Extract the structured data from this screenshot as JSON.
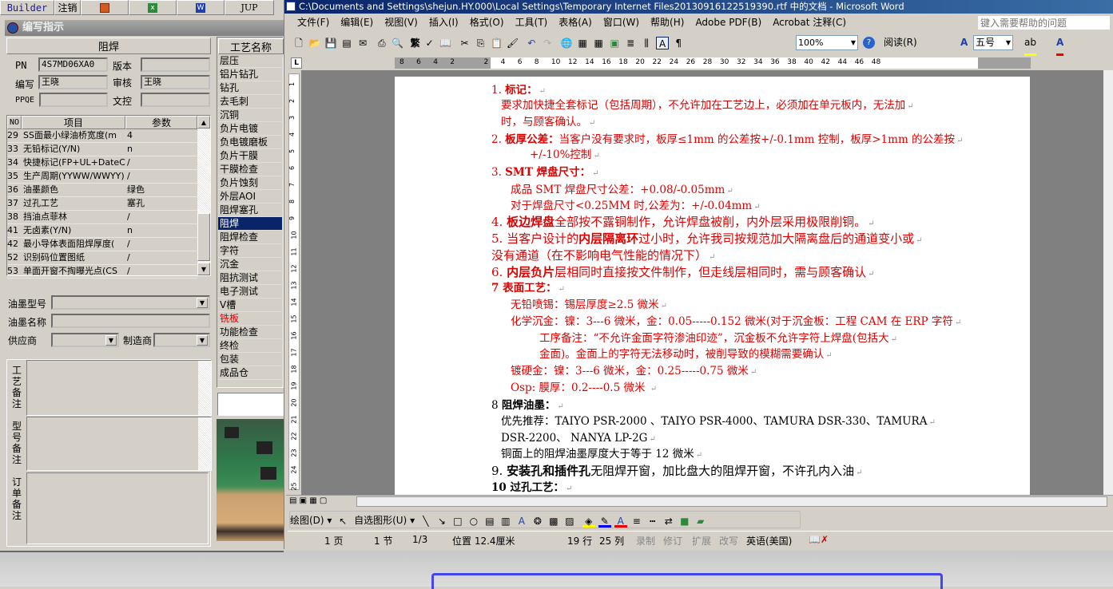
{
  "left_app": {
    "toolbar": {
      "builder": "Builder",
      "logout": "注销",
      "ppt_icon": "powerpoint-icon",
      "excel_icon": "excel-icon",
      "word_icon": "word-icon",
      "jup": "JUP"
    },
    "panel_title": "编写指示",
    "section_title": "阻焊",
    "fields": {
      "pn_label": "PN",
      "pn_value": "4S7MD06XA0",
      "version_label": "版本",
      "version_value": "",
      "writer_label": "编写",
      "writer_value": "王晓",
      "reviewer_label": "审核",
      "reviewer_value": "王晓",
      "ppqe_label": "PPQE",
      "ppqe_value": "",
      "doc_control_label": "文控",
      "doc_control_value": ""
    },
    "table": {
      "headers": [
        "NO",
        "项目",
        "参数"
      ],
      "rows": [
        [
          "29",
          "SS面最小绿油桥宽度(m",
          "4"
        ],
        [
          "33",
          "无铅标记(Y/N)",
          "n"
        ],
        [
          "34",
          "快捷标记(FP+UL+DateCo",
          "/"
        ],
        [
          "35",
          "生产周期(YYWW/WWYY)",
          "/"
        ],
        [
          "36",
          "油墨颜色",
          "绿色"
        ],
        [
          "37",
          "过孔工艺",
          "塞孔"
        ],
        [
          "38",
          "挡油点菲林",
          "/"
        ],
        [
          "41",
          "无卤素(Y/N)",
          "n"
        ],
        [
          "42",
          "最小导体表面阻焊厚度(",
          "/"
        ],
        [
          "52",
          "识别码位置图纸",
          "/"
        ],
        [
          "53",
          "单面开窗不掏曝光点(CS",
          "/"
        ]
      ]
    },
    "ink_model_label": "油墨型号",
    "ink_model_value": "",
    "ink_name_label": "油墨名称",
    "ink_name_value": "",
    "supplier_label": "供应商",
    "supplier_value": "",
    "manufacturer_label": "制造商",
    "manufacturer_value": "",
    "remarks": {
      "process": "工艺备注",
      "model": "型号备注",
      "order": "订单备注"
    },
    "process_list": {
      "header": "工艺名称",
      "selected": "阻焊",
      "highlight_color": "#e00000",
      "items": [
        "层压",
        "铝片钻孔",
        "钻孔",
        "去毛刺",
        "沉铜",
        "负片电镀",
        "负电镀磨板",
        "负片干膜",
        "干膜检查",
        "负片蚀刻",
        "外层AOI",
        "阻焊塞孔",
        "阻焊",
        "阻焊检查",
        "字符",
        "沉金",
        "阻抗测试",
        "电子测试",
        "V槽",
        "铣板",
        "功能检查",
        "终检",
        "包装",
        "成品仓"
      ],
      "highlighted": "铣板"
    }
  },
  "word": {
    "title": "C:\\Documents and Settings\\shejun.HY.000\\Local Settings\\Temporary Internet Files20130916122519390.rtf 中的文档 - Microsoft Word",
    "menu": [
      "文件(F)",
      "编辑(E)",
      "视图(V)",
      "插入(I)",
      "格式(O)",
      "工具(T)",
      "表格(A)",
      "窗口(W)",
      "帮助(H)",
      "Adobe PDF(B)",
      "Acrobat 注释(C)"
    ],
    "help_placeholder": "键入需要帮助的问题",
    "toolbar": {
      "traditional": "繁",
      "zoom": "100%",
      "read": "阅读(R)",
      "font_size": "五号"
    },
    "ruler_ticks": [
      "8",
      "6",
      "4",
      "2",
      "",
      "2",
      "4",
      "6",
      "8",
      "10",
      "12",
      "14",
      "16",
      "18",
      "20",
      "22",
      "24",
      "26",
      "28",
      "30",
      "32",
      "34",
      "36",
      "38",
      "40",
      "42",
      "44",
      "46",
      "48"
    ],
    "vruler_ticks": [
      "1",
      "2",
      "3",
      "4",
      "5",
      "6",
      "7",
      "8",
      "9",
      "10",
      "11",
      "12",
      "13",
      "14",
      "15",
      "16",
      "17",
      "18",
      "19",
      "20",
      "21",
      "22",
      "23",
      "24",
      "25"
    ],
    "doc_lines": [
      {
        "segs": [
          {
            "t": "1.  ",
            "b": false
          },
          {
            "t": "标记：",
            "b": true
          }
        ]
      },
      {
        "segs": [
          {
            "t": "要求加快捷全套标记（包括周期），不允许加在工艺边上，必须加在单元板内，无法加",
            "b": false
          }
        ],
        "indent": 1
      },
      {
        "segs": [
          {
            "t": "时，与顾客确认。",
            "b": false
          }
        ],
        "indent": 1
      },
      {
        "segs": [
          {
            "t": "2. ",
            "b": false
          },
          {
            "t": "板厚公差：",
            "b": true
          },
          {
            "t": "当客户没有要求时，板厚≤1mm 的公差按+/-0.1mm 控制，板厚>1mm 的公差按",
            "b": false
          }
        ]
      },
      {
        "segs": [
          {
            "t": "+/-10%控制",
            "b": false
          }
        ],
        "indent": 4
      },
      {
        "segs": [
          {
            "t": "3.  ",
            "b": false
          },
          {
            "t": "SMT 焊盘尺寸：",
            "b": true
          }
        ]
      },
      {
        "segs": [
          {
            "t": "成品 SMT 焊盘尺寸公差：+0.08/-0.05mm",
            "b": false
          }
        ],
        "indent": 2
      },
      {
        "segs": [
          {
            "t": "对于焊盘尺寸<0.25MM 时,公差为：+/-0.04mm",
            "b": false
          }
        ],
        "indent": 2
      },
      {
        "segs": [
          {
            "t": "4. ",
            "b": false
          },
          {
            "t": "板边焊盘",
            "b": true
          },
          {
            "t": "全部按不露铜制作，允许焊盘被削，内外层采用极限削铜。",
            "b": false
          }
        ],
        "big": true
      },
      {
        "segs": [
          {
            "t": "5. 当客户设计的",
            "b": false
          },
          {
            "t": "内层隔离环",
            "b": true
          },
          {
            "t": "过小时，允许我司按规范加大隔离盘后的通道变小或",
            "b": false
          }
        ],
        "big": true
      },
      {
        "segs": [
          {
            "t": "没有通道（在不影响电气性能的情况下）",
            "b": false
          }
        ],
        "big": true
      },
      {
        "segs": [
          {
            "t": "6. ",
            "b": false
          },
          {
            "t": "内层负片",
            "b": true
          },
          {
            "t": "层相同时直接按文件制作，但走线层相同时，需与顾客确认",
            "b": false
          }
        ],
        "big": true
      },
      {
        "segs": [
          {
            "t": "7 表面工艺：",
            "b": true
          }
        ]
      },
      {
        "segs": [
          {
            "t": "无铅喷锡：锡层厚度≥2.5 微米",
            "b": false
          }
        ],
        "indent": 2
      },
      {
        "segs": [
          {
            "t": "化学沉金：镍：3---6 微米，金：0.05-----0.152 微米(对于沉金板：工程 CAM 在 ERP 字符",
            "b": false
          }
        ],
        "indent": 2
      },
      {
        "segs": [
          {
            "t": "工序备注：“不允许金面字符渗油印迹”，沉金板不允许字符上焊盘(包括大",
            "b": false
          }
        ],
        "indent": 5
      },
      {
        "segs": [
          {
            "t": "金面)。金面上的字符无法移动时，被削导致的模糊需要确认",
            "b": false
          }
        ],
        "indent": 5
      },
      {
        "segs": [
          {
            "t": "镀硬金：镍：3---6 微米，金：0.25-----0.75 微米",
            "b": false
          }
        ],
        "indent": 2
      },
      {
        "segs": [
          {
            "t": "Osp:       膜厚：0.2----0.5 微米 ",
            "b": false
          }
        ],
        "indent": 2
      },
      {
        "segs": [
          {
            "t": "8 ",
            "b": false
          },
          {
            "t": "阻焊油墨：",
            "b": true
          }
        ],
        "black": true
      },
      {
        "segs": [
          {
            "t": "优先推荐：TAIYO PSR-2000 、TAIYO PSR-4000、TAMURA  DSR-330、TAMURA",
            "b": false
          }
        ],
        "indent": 1,
        "black": true
      },
      {
        "segs": [
          {
            "t": "DSR-2200、 NANYA LP-2G",
            "b": false
          }
        ],
        "indent": 1,
        "black": true
      },
      {
        "segs": [
          {
            "t": "铜面上的阻焊油墨厚度大于等于 12 微米",
            "b": false
          }
        ],
        "indent": 1,
        "black": true
      },
      {
        "segs": [
          {
            "t": "9.  ",
            "b": false
          },
          {
            "t": "安装孔和插件孔",
            "b": true
          },
          {
            "t": "无阻焊开窗，加比盘大的阻焊开窗，不许孔内入油",
            "b": false
          }
        ],
        "black": true,
        "big": true
      },
      {
        "segs": [
          {
            "t": "10  过孔工艺：",
            "b": true
          }
        ],
        "black": true
      }
    ],
    "drawing_toolbar": {
      "draw": "绘图(D)",
      "autoshapes": "自选图形(U)"
    },
    "status": {
      "page": "1 页",
      "section": "1 节",
      "pages": "1/3",
      "position": "位置 12.4厘米",
      "line": "19 行",
      "column": "25 列",
      "rec": "录制",
      "trk": "修订",
      "ext": "扩展",
      "ovr": "改写",
      "language": "英语(美国)"
    },
    "colors": {
      "title_bar": "#0a246a",
      "doc_red": "#e00000",
      "selection": "#0a246a"
    }
  }
}
